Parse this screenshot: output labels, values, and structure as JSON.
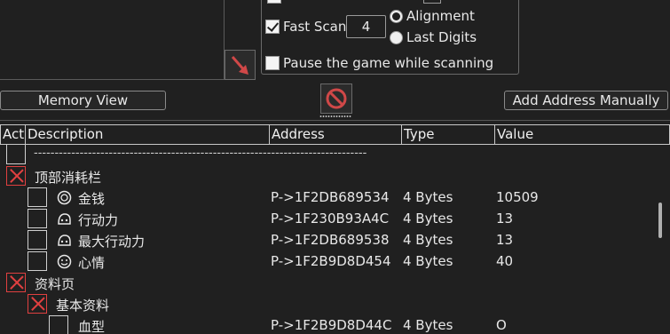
{
  "scan_options": {
    "fast_scan_label": "Fast Scan",
    "fast_scan_checked": true,
    "fast_scan_value": "4",
    "alignment_label": "Alignment",
    "last_digits_label": "Last Digits",
    "alignment_selected": true,
    "pause_label": "Pause the game while scanning",
    "pause_checked": false
  },
  "toolbar": {
    "memory_view_label": "Memory View",
    "add_address_label": "Add Address Manually"
  },
  "table": {
    "headers": [
      "Act",
      "Description",
      "Address",
      "Type",
      "Value"
    ]
  },
  "rows": [
    {
      "kind": "separator",
      "text": "--------------------------------------------------------------------------------"
    },
    {
      "kind": "group",
      "desc": "顶部消耗栏",
      "active": true
    },
    {
      "kind": "item",
      "icon": "coin-icon",
      "desc": "金钱",
      "address": "P->1F2DB689534",
      "type": "4 Bytes",
      "value": "10509"
    },
    {
      "kind": "item",
      "icon": "helmet-icon",
      "desc": "行动力",
      "address": "P->1F230B93A4C",
      "type": "4 Bytes",
      "value": "13"
    },
    {
      "kind": "item",
      "icon": "helmet-icon",
      "desc": "最大行动力",
      "address": "P->1F2DB689538",
      "type": "4 Bytes",
      "value": "13"
    },
    {
      "kind": "item",
      "icon": "smiley-icon",
      "desc": "心情",
      "address": "P->1F2B9D8D454",
      "type": "4 Bytes",
      "value": "40"
    },
    {
      "kind": "group",
      "desc": "资料页",
      "active": true
    },
    {
      "kind": "subgroup",
      "desc": "基本资料",
      "active": true
    },
    {
      "kind": "subitem",
      "desc": "血型",
      "address": "P->1F2B9D8D44C",
      "type": "4 Bytes",
      "value": "O"
    }
  ],
  "colors": {
    "background": "#202020",
    "text": "#e8e8e8",
    "active_x": "#e04040"
  }
}
